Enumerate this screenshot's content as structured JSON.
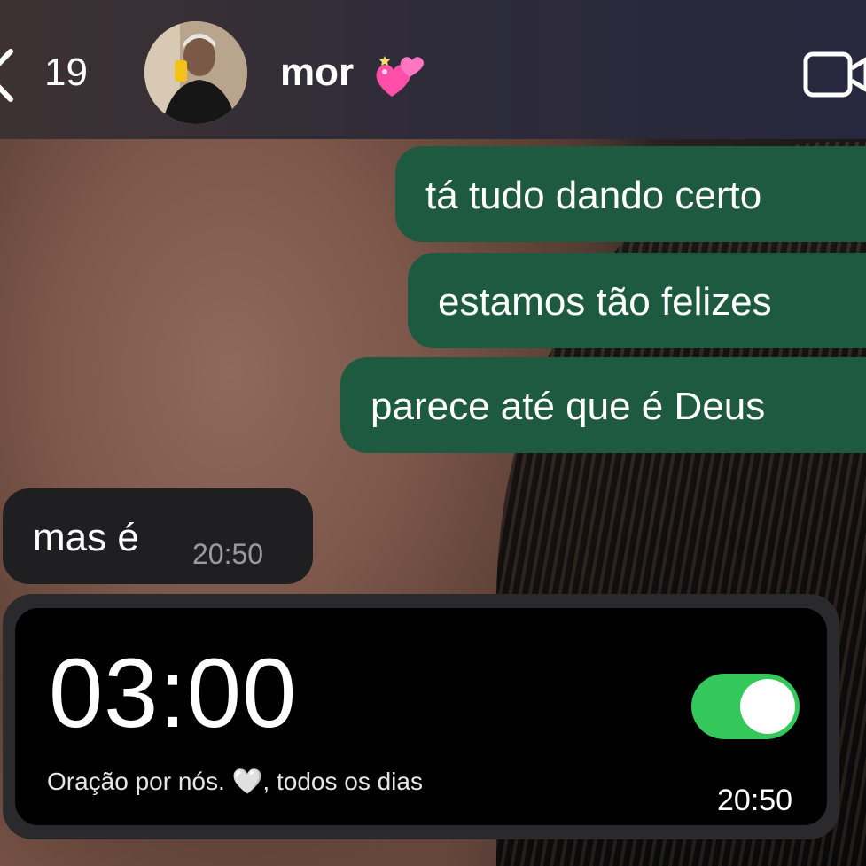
{
  "header": {
    "back_count": "19",
    "contact_name": "mor",
    "heart_emoji": "💞"
  },
  "messages": [
    {
      "direction": "outgoing",
      "text": "tá tudo dando certo"
    },
    {
      "direction": "outgoing",
      "text": "estamos tão felizes"
    },
    {
      "direction": "outgoing",
      "text": "parece até que é Deus"
    },
    {
      "direction": "incoming",
      "text": "mas é",
      "time": "20:50"
    }
  ],
  "alarm_message": {
    "alarm_time": "03:00",
    "label": "Oração por nós. 🤍, todos os dias",
    "toggle_on": true,
    "time": "20:50"
  },
  "colors": {
    "outgoing_bubble": "#1e5a40",
    "incoming_bubble": "#1f1f22",
    "toggle_green": "#34c759"
  }
}
